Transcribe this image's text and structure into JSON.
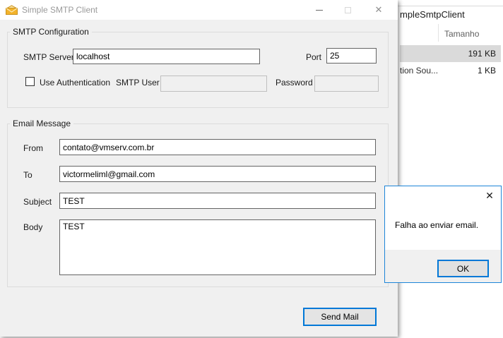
{
  "colors": {
    "accent": "#0078d7",
    "window_bg": "#f0f0f0",
    "titlebar_bg": "#ffffff",
    "selected_row": "#dadada",
    "dialog_border": "#1d85d8"
  },
  "smtp_window": {
    "title": "Simple SMTP Client",
    "icons": {
      "app_icon": "envelope",
      "close_glyph": "✕"
    },
    "smtp_group": {
      "title": "SMTP Configuration",
      "server_label": "SMTP Server",
      "server_value": "localhost",
      "port_label": "Port",
      "port_value": "25",
      "auth_checkbox_label": "Use Authentication",
      "auth_checked": false,
      "user_label": "SMTP User",
      "user_value": "",
      "password_label": "Password",
      "password_value": ""
    },
    "message_group": {
      "title": "Email Message",
      "from_label": "From",
      "from_value": "contato@vmserv.com.br",
      "to_label": "To",
      "to_value": "victormeliml@gmail.com",
      "subject_label": "Subject",
      "subject_value": "TEST",
      "body_label": "Body",
      "body_value": "TEST"
    },
    "send_button_label": "Send Mail"
  },
  "error_dialog": {
    "message": "Falha ao enviar email.",
    "ok_label": "OK",
    "close_glyph": "✕"
  },
  "explorer_window": {
    "address_text": "mpleSmtpClient",
    "column_header": "Tamanho",
    "rows": [
      {
        "name": "",
        "size": "191 KB"
      },
      {
        "name": "tion Sou...",
        "size": "1 KB"
      }
    ]
  }
}
